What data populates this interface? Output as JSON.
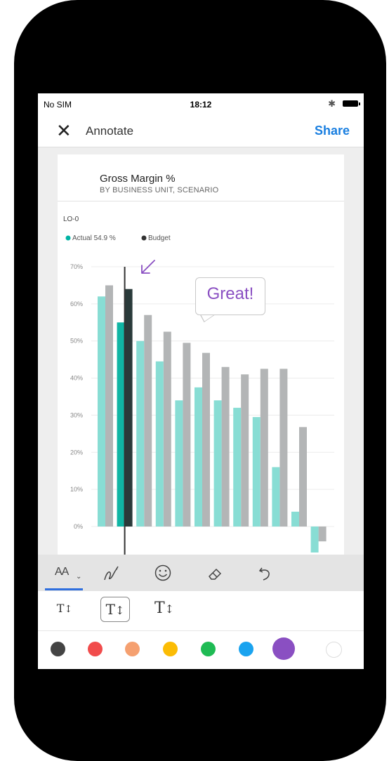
{
  "status_bar": {
    "carrier": "No SIM",
    "time": "18:12"
  },
  "nav": {
    "close_label": "✕",
    "title": "Annotate",
    "share_label": "Share"
  },
  "card": {
    "title": "Gross Margin %",
    "subtitle": "BY BUSINESS UNIT, SCENARIO"
  },
  "annotation": {
    "text": "Great!"
  },
  "chart_data": {
    "type": "bar",
    "subtitle": "LO-0",
    "legend": [
      {
        "name": "Actual",
        "value": "54.9 %",
        "color": "#00b3a4"
      },
      {
        "name": "Budget",
        "color": "#333333"
      }
    ],
    "ylim": [
      -6,
      70
    ],
    "y_ticks": [
      "70%",
      "60%",
      "50%",
      "40%",
      "30%",
      "20%",
      "10%",
      "0%"
    ],
    "series": [
      {
        "name": "Actual",
        "values": [
          62,
          55,
          50,
          44.5,
          34,
          37.5,
          34,
          32,
          29.5,
          16,
          4,
          -7
        ]
      },
      {
        "name": "Budget",
        "values": [
          65,
          64,
          57,
          52.5,
          49.5,
          46.8,
          43,
          41,
          42.5,
          42.5,
          26.8,
          -4
        ]
      }
    ],
    "highlight_index": 1,
    "colors": {
      "actual": "#88ddd4",
      "budget": "#b3b5b6",
      "actual_highlight": "#10b5a4",
      "budget_highlight": "#2a3a3a",
      "annotation": "#8a4fc2"
    }
  },
  "toolbar": {
    "tools": [
      "text-size",
      "pen",
      "emoji",
      "eraser",
      "undo"
    ],
    "text_tool_label": "AA"
  },
  "sizes": {
    "small": "T",
    "medium": "T",
    "large": "T"
  },
  "colors": {
    "swatches": [
      "#444444",
      "#f14c4c",
      "#f5a070",
      "#fbbc05",
      "#1fbb54",
      "#1aa3ef",
      "#8a4fc2",
      "#ffffff"
    ],
    "selected_index": 6
  }
}
